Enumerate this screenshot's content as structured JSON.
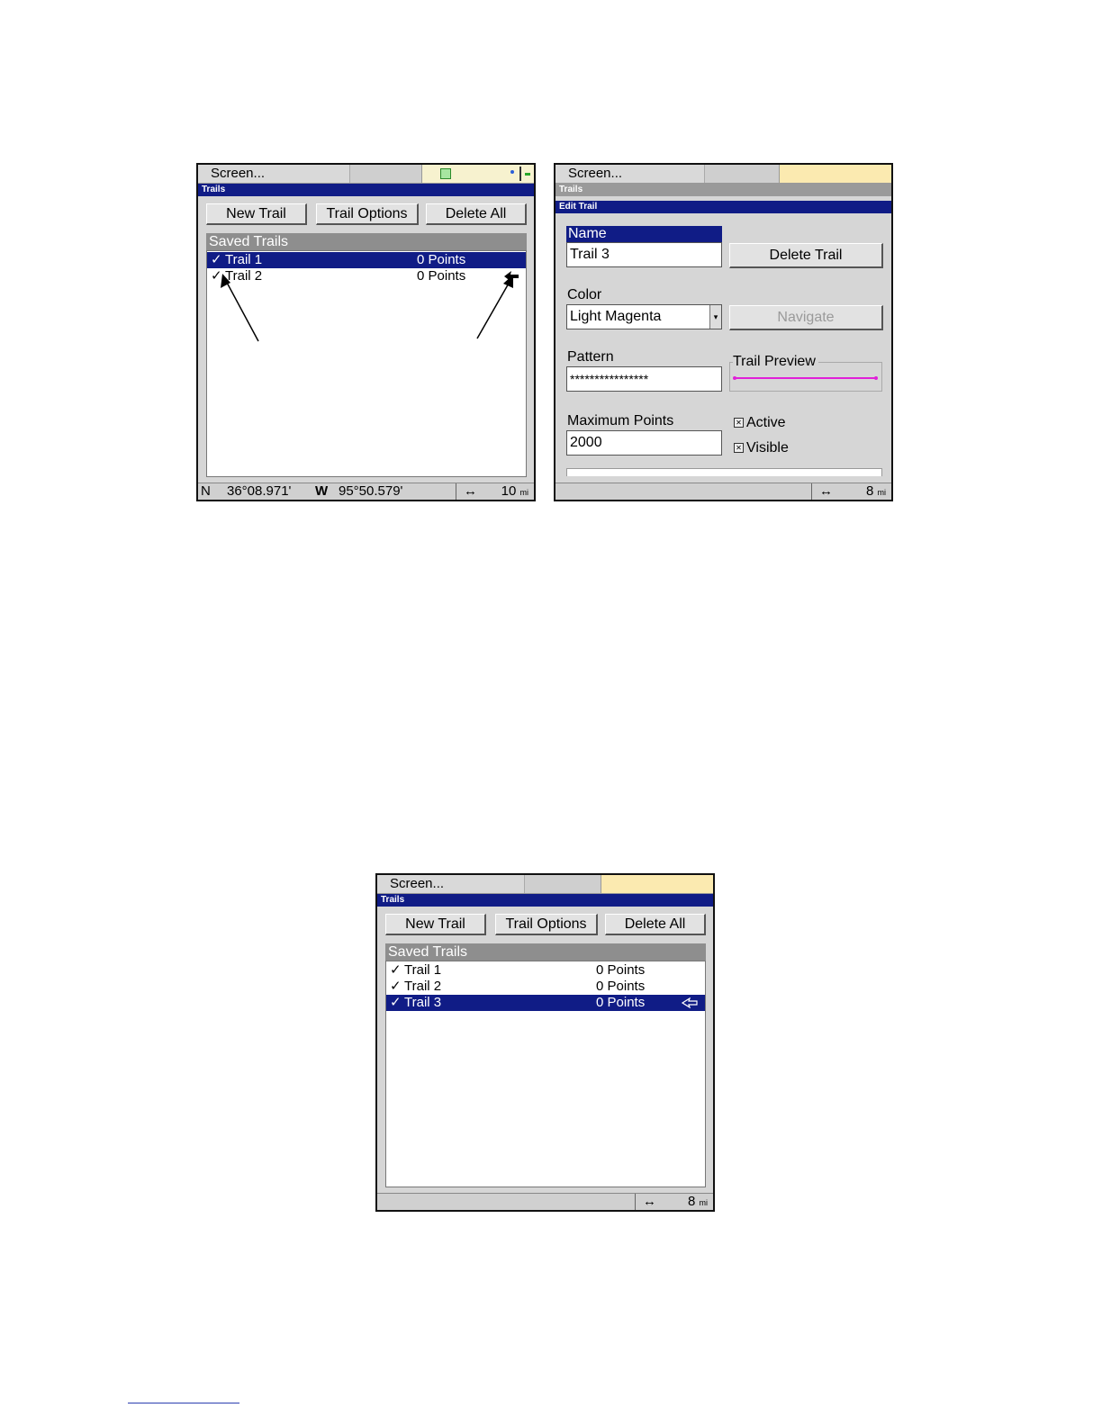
{
  "screens": {
    "trails_list_1": {
      "menu_label": "Screen...",
      "title": "Trails",
      "buttons": {
        "new_trail": "New Trail",
        "trail_options": "Trail Options",
        "delete_all": "Delete All"
      },
      "list_header": "Saved Trails",
      "rows": [
        {
          "check": "✓",
          "name": "Trail 1",
          "points": "0 Points",
          "selected": true
        },
        {
          "check": "✓",
          "name": "Trail 2",
          "points": "0 Points",
          "selected": false
        }
      ],
      "status": {
        "lat_hemi": "N",
        "lat": "36°08.971'",
        "lon_hemi": "W",
        "lon": "95°50.579'",
        "scale_icon": "↔",
        "scale_value": "10",
        "scale_unit": "mi"
      }
    },
    "edit_trail": {
      "menu_label": "Screen...",
      "title": "Trails",
      "dialog_title": "Edit Trail",
      "name_label": "Name",
      "name_value": "Trail 3",
      "delete_trail": "Delete Trail",
      "color_label": "Color",
      "color_value": "Light Magenta",
      "navigate": "Navigate",
      "pattern_label": "Pattern",
      "pattern_value": "****************",
      "trail_preview_label": "Trail Preview",
      "trail_color": "#e020d8",
      "max_points_label": "Maximum Points",
      "max_points_value": "2000",
      "active_label": "Active",
      "visible_label": "Visible",
      "active_checked": true,
      "visible_checked": true,
      "status": {
        "scale_icon": "↔",
        "scale_value": "8",
        "scale_unit": "mi"
      }
    },
    "trails_list_2": {
      "menu_label": "Screen...",
      "title": "Trails",
      "buttons": {
        "new_trail": "New Trail",
        "trail_options": "Trail Options",
        "delete_all": "Delete All"
      },
      "list_header": "Saved Trails",
      "rows": [
        {
          "check": "✓",
          "name": "Trail 1",
          "points": "0 Points",
          "selected": false
        },
        {
          "check": "✓",
          "name": "Trail 2",
          "points": "0 Points",
          "selected": false
        },
        {
          "check": "✓",
          "name": "Trail 3",
          "points": "0 Points",
          "selected": true
        }
      ],
      "status": {
        "scale_icon": "↔",
        "scale_value": "8",
        "scale_unit": "mi"
      }
    }
  },
  "colors": {
    "title_blue": "#101c86",
    "highlight_yellow": "#fbeab0"
  }
}
